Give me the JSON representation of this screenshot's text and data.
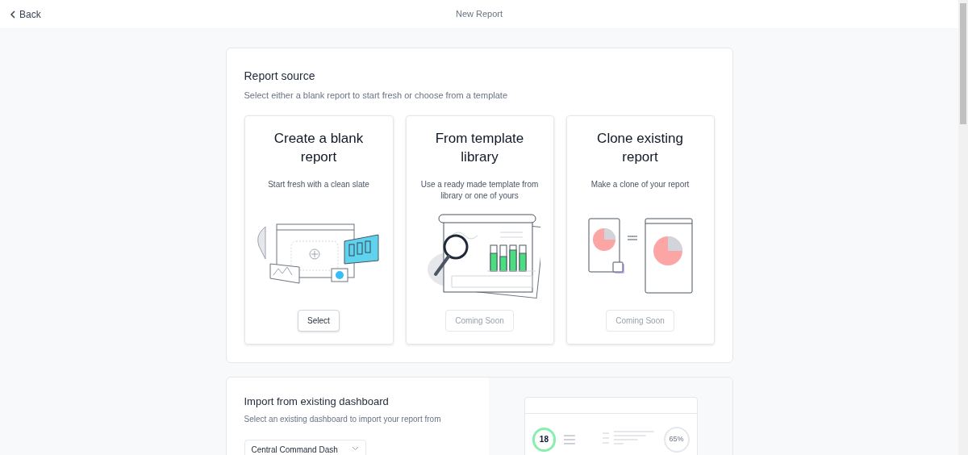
{
  "header": {
    "back": "Back",
    "title": "New Report"
  },
  "report_source": {
    "title": "Report source",
    "subtitle": "Select either a blank report to start fresh or choose from a template",
    "options": [
      {
        "kind": "blank",
        "title": "Create a blank report",
        "description": "Start fresh with a clean slate",
        "button": {
          "label": "Select",
          "disabled": false
        }
      },
      {
        "kind": "template",
        "title": "From template library",
        "description": "Use a ready made template from library or one of yours",
        "button": {
          "label": "Coming Soon",
          "disabled": true
        }
      },
      {
        "kind": "clone",
        "title": "Clone existing report",
        "description": "Make a clone of your report",
        "button": {
          "label": "Coming Soon",
          "disabled": true
        }
      }
    ]
  },
  "import": {
    "title": "Import from existing dashboard",
    "subtitle": "Select an existing dashboard to import your report from",
    "dashboard_select": {
      "value": "Central Command Dash"
    },
    "preview": {
      "count": "18",
      "percent": "65%"
    }
  }
}
